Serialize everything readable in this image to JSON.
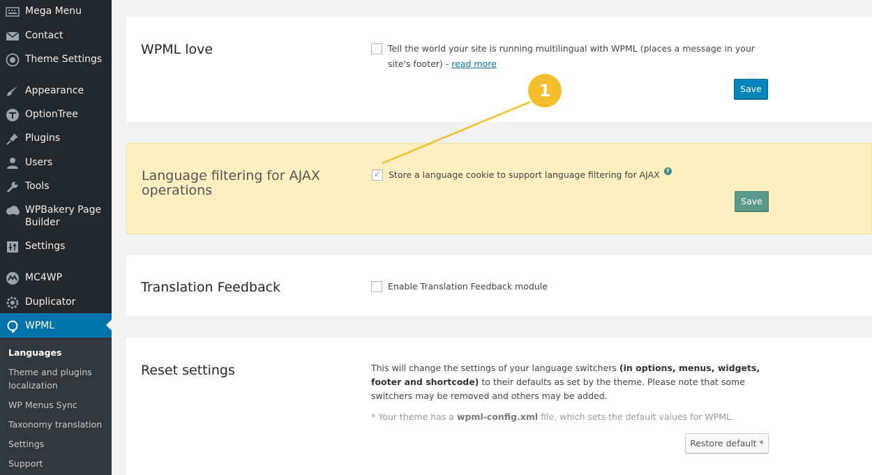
{
  "sidebar": {
    "items": [
      {
        "label": "Mega Menu",
        "icon": "keyboard-icon"
      },
      {
        "label": "Contact",
        "icon": "envelope-icon"
      },
      {
        "label": "Theme Settings",
        "icon": "theme-settings-icon"
      },
      {
        "label": "Appearance",
        "icon": "paintbrush-icon"
      },
      {
        "label": "OptionTree",
        "icon": "optiontree-icon"
      },
      {
        "label": "Plugins",
        "icon": "plugin-icon"
      },
      {
        "label": "Users",
        "icon": "user-icon"
      },
      {
        "label": "Tools",
        "icon": "wrench-icon"
      },
      {
        "label": "WPBakery Page Builder",
        "icon": "cloud-icon"
      },
      {
        "label": "Settings",
        "icon": "settings-sliders-icon"
      },
      {
        "label": "MC4WP",
        "icon": "mc4wp-icon"
      },
      {
        "label": "Duplicator",
        "icon": "duplicator-gear-icon"
      },
      {
        "label": "WPML",
        "icon": "wpml-icon"
      }
    ],
    "submenu": [
      "Languages",
      "Theme and plugins localization",
      "WP Menus Sync",
      "Taxonomy translation",
      "Settings",
      "Support"
    ]
  },
  "panels": {
    "wpml_love": {
      "title": "WPML love",
      "checkbox_text": "Tell the world your site is running multilingual with WPML (places a message in your site's footer) - ",
      "link": "read more",
      "checked": false,
      "save": "Save"
    },
    "ajax": {
      "title": "Language filtering for AJAX operations",
      "checkbox_text": "Store a language cookie to support language filtering for AJAX",
      "checked": true,
      "save": "Save"
    },
    "feedback": {
      "title": "Translation Feedback",
      "checkbox_text": "Enable Translation Feedback module",
      "checked": false
    },
    "reset": {
      "title": "Reset settings",
      "desc_1": "This will change the settings of your language switchers ",
      "desc_bold": "(in options, menus, widgets, footer and shortcode)",
      "desc_2": " to their defaults as set by the theme. Please note that some switchers may be removed and others may be added.",
      "note_1": "* Your theme has a ",
      "note_bold": "wpml-config.xml",
      "note_2": " file, which sets the default values for WPML.",
      "restore": "Restore default *"
    }
  },
  "annotation": {
    "number": "1",
    "color": "#f7be2c"
  },
  "colors": {
    "primary": "#0085ba",
    "sidebar": "#23282d",
    "current": "#0073aa",
    "highlight": "#fdefc0"
  }
}
